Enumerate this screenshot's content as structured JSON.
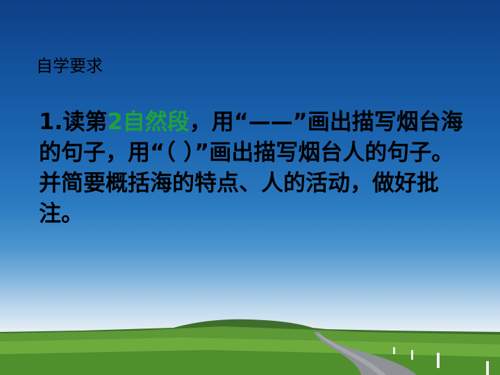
{
  "slide": {
    "heading": "自学要求",
    "task": {
      "part1": "1.读第",
      "highlight": "2自然段",
      "part2": "，用“——”画出描写烟台海的句子，用“（  ）”画出描写烟台人的句子。并简要概括海的特点、人的活动，做好批注。"
    }
  },
  "colors": {
    "highlight": "#1fa23a",
    "text": "#000000",
    "sky_top": "#0e3f86",
    "grass": "#4c8c2a"
  },
  "icons": [
    "sky-landscape-background"
  ]
}
